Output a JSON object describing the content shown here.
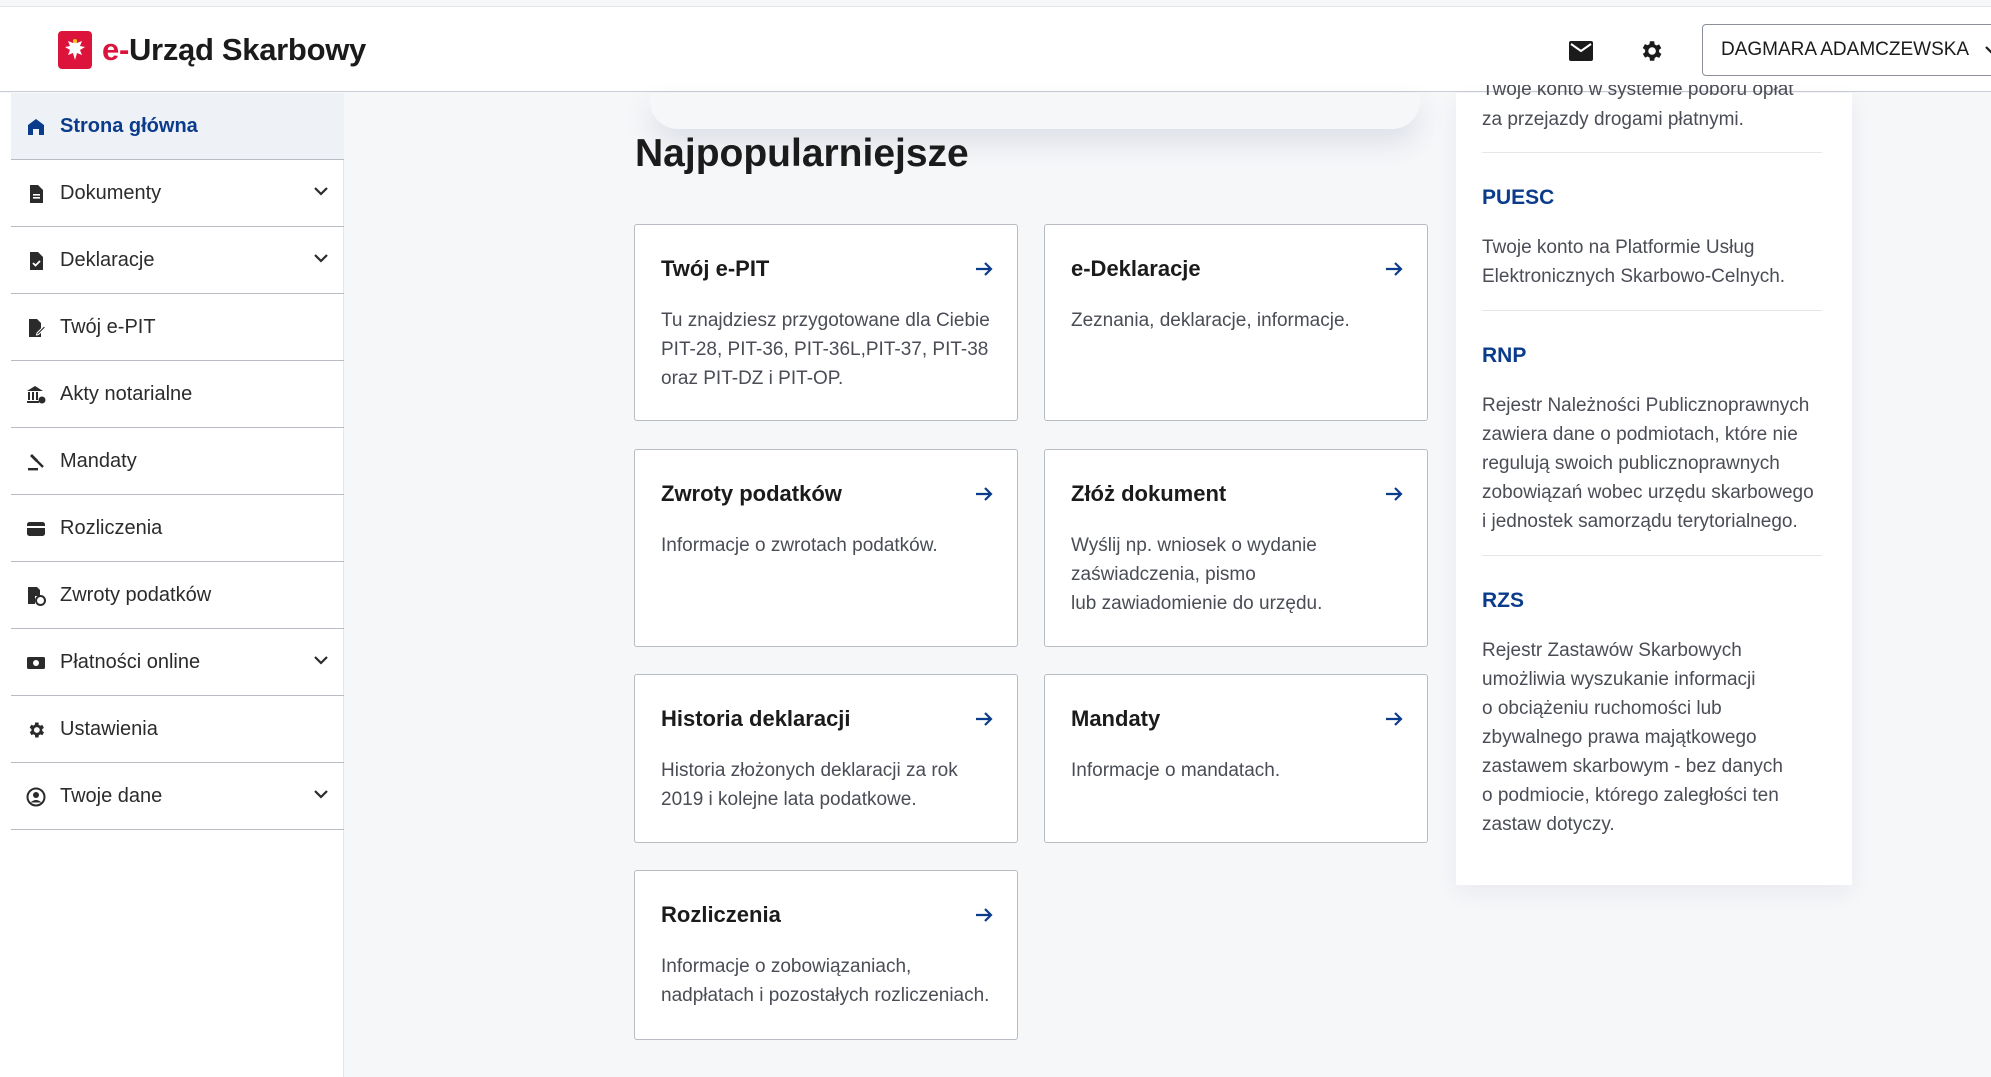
{
  "header": {
    "app_name_prefix": "e-",
    "app_name_rest": "Urząd Skarbowy",
    "user_name": "DAGMARA ADAMCZEWSKA",
    "colors": {
      "brand_red": "#dc143c",
      "link_blue": "#0b3c8c"
    }
  },
  "sidebar": {
    "items": [
      {
        "label": "Strona główna",
        "icon": "home-icon",
        "active": true,
        "expandable": false
      },
      {
        "label": "Dokumenty",
        "icon": "document-icon",
        "active": false,
        "expandable": true
      },
      {
        "label": "Deklaracje",
        "icon": "declaration-icon",
        "active": false,
        "expandable": true
      },
      {
        "label": "Twój e-PIT",
        "icon": "epit-icon",
        "active": false,
        "expandable": false
      },
      {
        "label": "Akty notarialne",
        "icon": "notary-icon",
        "active": false,
        "expandable": false
      },
      {
        "label": "Mandaty",
        "icon": "gavel-icon",
        "active": false,
        "expandable": false
      },
      {
        "label": "Rozliczenia",
        "icon": "wallet-icon",
        "active": false,
        "expandable": false
      },
      {
        "label": "Zwroty podatków",
        "icon": "refund-icon",
        "active": false,
        "expandable": false
      },
      {
        "label": "Płatności online",
        "icon": "payment-icon",
        "active": false,
        "expandable": true
      },
      {
        "label": "Ustawienia",
        "icon": "gear-icon",
        "active": false,
        "expandable": false
      },
      {
        "label": "Twoje dane",
        "icon": "user-circle-icon",
        "active": false,
        "expandable": true
      }
    ]
  },
  "main": {
    "section_title": "Najpopularniejsze",
    "cards": [
      {
        "title": "Twój e-PIT",
        "desc": "Tu znajdziesz przygotowane dla Ciebie\nPIT-28, PIT-36, PIT-36L,PIT-37, PIT-38\noraz PIT-DZ i PIT-OP."
      },
      {
        "title": "e-Deklaracje",
        "desc": "Zeznania, deklaracje, informacje."
      },
      {
        "title": "Zwroty podatków",
        "desc": "Informacje o zwrotach podatków."
      },
      {
        "title": "Złóż dokument",
        "desc": "Wyślij np. wniosek o wydanie\nzaświadczenia, pismo\nlub zawiadomienie do urzędu."
      },
      {
        "title": "Historia deklaracji",
        "desc": "Historia złożonych deklaracji za rok\n2019 i kolejne lata podatkowe."
      },
      {
        "title": "Mandaty",
        "desc": "Informacje o mandatach."
      },
      {
        "title": "Rozliczenia",
        "desc": "Informacje o zobowiązaniach,\nnadpłatach i pozostałych rozliczeniach."
      }
    ]
  },
  "right_panel": {
    "cut_text_1": "Twoje konto w systemie poboru opłat",
    "cut_text_2": "za przejazdy drogami płatnymi.",
    "links": [
      {
        "title": "PUESC",
        "desc": "Twoje konto na Platformie Usług\nElektronicznych Skarbowo-Celnych."
      },
      {
        "title": "RNP",
        "desc": "Rejestr Należności Publicznoprawnych\nzawiera dane o podmiotach, które nie\nregulują swoich publicznoprawnych\nzobowiązań wobec urzędu skarbowego\ni jednostek samorządu terytorialnego."
      },
      {
        "title": "RZS",
        "desc": "Rejestr Zastawów Skarbowych\numożliwia wyszukanie informacji\no obciążeniu ruchomości lub\nzbywalnego prawa majątkowego\nzastawem skarbowym - bez danych\no podmiocie, którego zaległości ten\nzastaw dotyczy."
      }
    ]
  }
}
